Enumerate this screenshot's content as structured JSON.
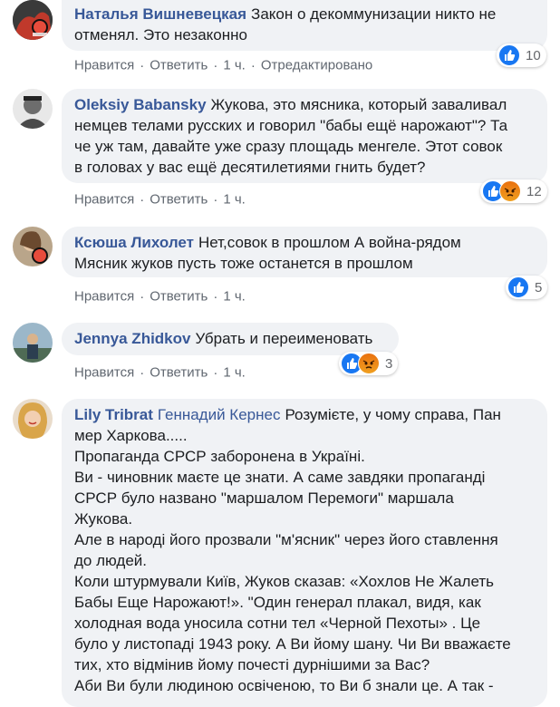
{
  "comments": [
    {
      "author": "Наталья Вишневецкая",
      "text": "Закон о декоммунизации никто не\nотменял. Это незаконно",
      "like": "Нравится",
      "reply": "Ответить",
      "time": "1 ч.",
      "edited": "Отредактировано",
      "reactions_count": "10",
      "reaction_icons": [
        "like-icon"
      ]
    },
    {
      "author": "Oleksiy Babansky",
      "text": "Жукова, это мясника, который заваливал\nнемцев телами русских и говорил \"бабы ещё нарожают\"? Та\nче уж там, давайте уже сразу площадь менгеле. Этот совок\nв головах у вас ещё десятилетиями гнить будет?",
      "like": "Нравится",
      "reply": "Ответить",
      "time": "1 ч.",
      "reactions_count": "12",
      "reaction_icons": [
        "like-icon",
        "angry-icon"
      ]
    },
    {
      "author": "Ксюша Лихолет",
      "text": "Нет,совок в прошлом А война-рядом\nМясник жуков пусть тоже останется в прошлом",
      "like": "Нравится",
      "reply": "Ответить",
      "time": "1 ч.",
      "reactions_count": "5",
      "reaction_icons": [
        "like-icon"
      ]
    },
    {
      "author": "Jennya Zhidkov",
      "text": "Убрать и переименовать",
      "like": "Нравится",
      "reply": "Ответить",
      "time": "1 ч.",
      "reactions_count": "3",
      "reaction_icons": [
        "like-icon",
        "angry-icon"
      ]
    },
    {
      "author": "Lily Tribrat",
      "mention": "Геннадий Кернес",
      "text": "Розумієте, у чому справа, Пан\nмер Харкова.....\nПропаганда СРСР заборонена в Україні.\nВи - чиновник маєте це знати. А саме завдяки пропаганді\nСРСР було названо \"маршалом Перемоги\" маршала\nЖукова.\nАле в народі його прозвали \"м'ясник\" через його ставлення\nдо людей.\nКоли штурмували Київ, Жуков сказав: «Хохлов Не Жалеть\nБабы Еще Нарожают!». \"Один генерал плакал, видя, как\nхолодная вода уносила сотни тел «Черной Пехоты» . Це\nбуло у листопаді 1943 року. А Ви йому шану. Чи Ви вважаєте\nтих, хто відмінив йому почесті дурнішими за Вас?\nАби Ви були людиною освіченою, то Ви б знали це. А так -"
    }
  ],
  "colors": {
    "author": "#385898",
    "bubble": "#f0f2f5",
    "meta": "#606770",
    "like": "#1877f2",
    "angry": "#e9710f"
  }
}
